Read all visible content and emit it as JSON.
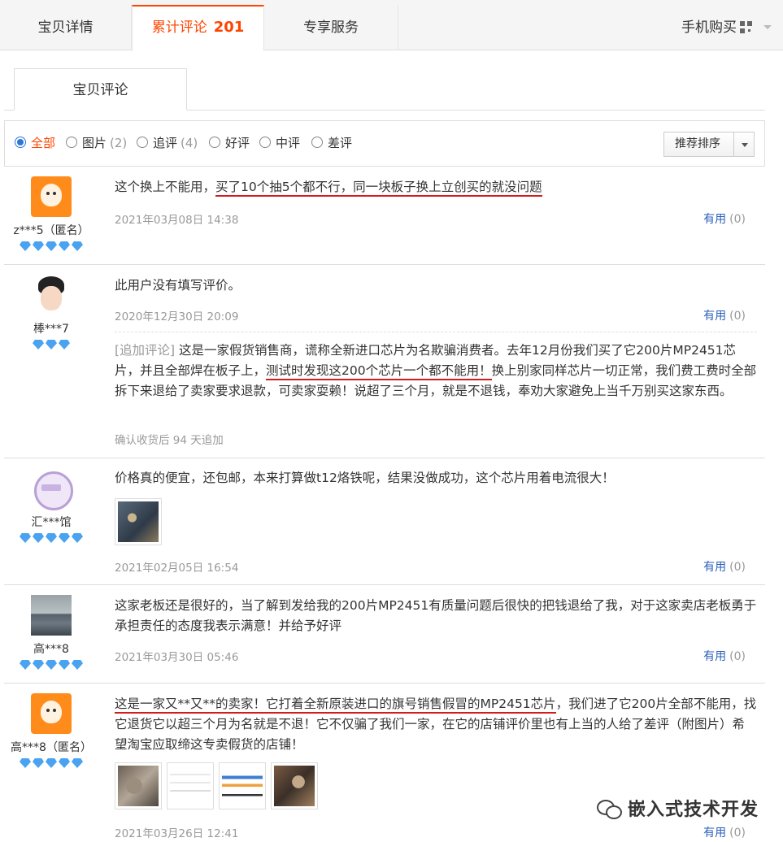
{
  "tabs": {
    "details": "宝贝详情",
    "reviews_label": "累计评论",
    "reviews_count": "201",
    "service": "专享服务",
    "mobile_buy": "手机购买"
  },
  "subtab": "宝贝评论",
  "filters": [
    {
      "label": "全部",
      "count": "",
      "selected": true
    },
    {
      "label": "图片",
      "count": "(2)"
    },
    {
      "label": "追评",
      "count": "(4)"
    },
    {
      "label": "好评",
      "count": ""
    },
    {
      "label": "中评",
      "count": ""
    },
    {
      "label": "差评",
      "count": ""
    }
  ],
  "sort": "推荐排序",
  "useful_label": "有用",
  "reviews": [
    {
      "user": "z***5（匿名）",
      "diamonds": 5,
      "text_a": "这个换上不能用，",
      "text_u": "买了10个抽5个都不行，同一块板子换上立创买的就没问题",
      "date": "2021年03月08日 14:38",
      "useful": "(0)"
    },
    {
      "user": "棒***7",
      "diamonds": 3,
      "text": "此用户没有填写评价。",
      "date": "2020年12月30日 20:09",
      "useful": "(0)",
      "append_label": "[追加评论]",
      "append_a": "这是一家假货销售商，谎称全新进口芯片为名欺骗消费者。去年12月份我们买了它200片MP2451芯片，并且全部焊在板子上，",
      "append_u": "测试时发现这200个芯片一个都不能用！",
      "append_b": "换上别家同样芯片一切正常，我们费工费时全部拆下来退给了卖家要求退款，可卖家耍赖！说超了三个月，就是不退钱，奉劝大家避免上当千万别买这家东西。",
      "append_meta": "确认收货后 94 天追加"
    },
    {
      "user": "汇***馆",
      "diamonds": 5,
      "text": "价格真的便宜，还包邮，本来打算做t12烙铁呢，结果没做成功，这个芯片用着电流很大！",
      "date": "2021年02月05日 16:54",
      "useful": "(0)"
    },
    {
      "user": "高***8",
      "diamonds": 5,
      "text": "这家老板还是很好的，当了解到发给我的200片MP2451有质量问题后很快的把钱退给了我，对于这家卖店老板勇于承担责任的态度我表示满意！并给予好评",
      "date": "2021年03月30日 05:46",
      "useful": "(0)"
    },
    {
      "user": "高***8（匿名）",
      "diamonds": 5,
      "text_u": "这是一家又**又**的卖家！它打着全新原装进口的旗号销售假冒的MP2451芯片",
      "text_b": "，我们进了它200片全部不能用，找它退货它以超三个月为名就是不退！它不仅骗了我们一家，在它的店铺评价里也有上当的人给了差评（附图片）希望淘宝应取缔这专卖假货的店铺！",
      "date": "2021年03月26日 12:41",
      "useful": "(0)"
    }
  ],
  "watermark": "嵌入式技术开发",
  "colors": {
    "accent": "#ff4400",
    "link": "#2b5fb8",
    "underline": "#d21d1d",
    "diamond": "#4aa3f0"
  }
}
